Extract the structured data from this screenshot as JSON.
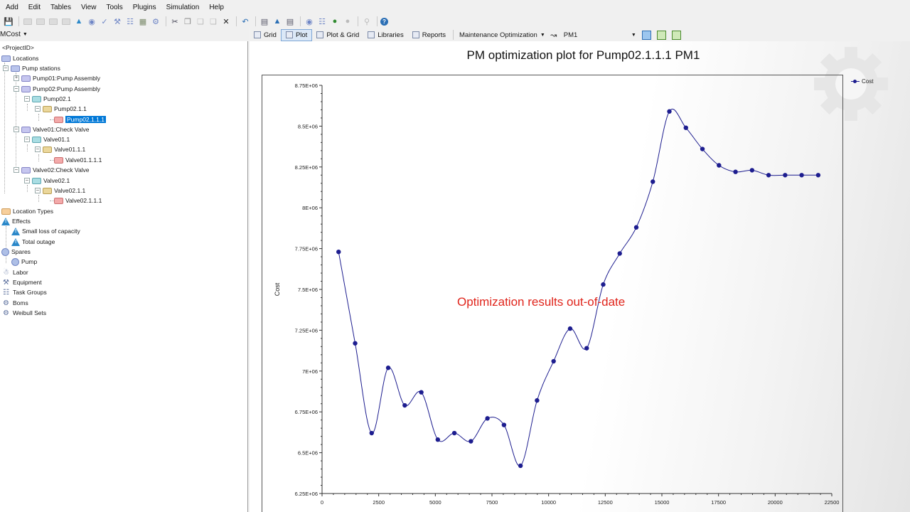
{
  "menu": [
    "Add",
    "Edit",
    "Tables",
    "View",
    "Tools",
    "Plugins",
    "Simulation",
    "Help"
  ],
  "left_header": {
    "label": "MCost"
  },
  "tree": {
    "project_label": "<ProjectID>",
    "locations": "Locations",
    "pump_stations": "Pump stations",
    "pump01": "Pump01:Pump Assembly",
    "pump02": "Pump02:Pump Assembly",
    "pump02_1": "Pump02.1",
    "pump02_1_1": "Pump02.1.1",
    "pump02_1_1_1": "Pump02.1.1.1",
    "valve01": "Valve01:Check Valve",
    "valve01_1": "Valve01.1",
    "valve01_1_1": "Valve01.1.1",
    "valve01_1_1_1": "Valve01.1.1.1",
    "valve02": "Valve02:Check Valve",
    "valve02_1": "Valve02.1",
    "valve02_1_1": "Valve02.1.1",
    "valve02_1_1_1": "Valve02.1.1.1",
    "location_types": "Location Types",
    "effects": "Effects",
    "small_loss": "Small loss of capacity",
    "total_outage": "Total outage",
    "spares": "Spares",
    "pump": "Pump",
    "labor": "Labor",
    "equipment": "Equipment",
    "task_groups": "Task Groups",
    "boms": "Boms",
    "weibull_sets": "Weibull Sets"
  },
  "tabs": {
    "grid": "Grid",
    "plot": "Plot",
    "plot_grid": "Plot & Grid",
    "libraries": "Libraries",
    "reports": "Reports",
    "maintenance": "Maintenance Optimization",
    "pm_select": "PM1"
  },
  "plot": {
    "title": "PM optimization plot for Pump02.1.1.1 PM1",
    "warning": "Optimization results out-of-date",
    "legend": "Cost"
  },
  "colors": {
    "series": "#1d1d8f",
    "warning": "#e0241b",
    "selection": "#0078d7"
  },
  "chart_data": {
    "type": "line",
    "title": "PM optimization plot for Pump02.1.1.1 PM1",
    "xlabel": "",
    "ylabel": "Cost",
    "xlim": [
      0,
      22500
    ],
    "ylim": [
      6250000,
      8750000
    ],
    "x_ticks": [
      "0",
      "2500",
      "5000",
      "7500",
      "10000",
      "12500",
      "15000",
      "17500",
      "20000",
      "22500"
    ],
    "y_ticks": [
      "6.25E+06",
      "6.5E+06",
      "6.75E+06",
      "7E+06",
      "7.25E+06",
      "7.5E+06",
      "7.75E+06",
      "8E+06",
      "8.25E+06",
      "8.5E+06",
      "8.75E+06"
    ],
    "legend_position": "top-right",
    "series": [
      {
        "name": "Cost",
        "x": [
          730,
          1460,
          2190,
          2920,
          3650,
          4380,
          5110,
          5840,
          6570,
          7300,
          8030,
          8760,
          9490,
          10220,
          10950,
          11680,
          12410,
          13140,
          13870,
          14600,
          15330,
          16060,
          16790,
          17520,
          18250,
          18980,
          19710,
          20440,
          21170,
          21900
        ],
        "y": [
          7730000,
          7170000,
          6620000,
          7020000,
          6790000,
          6870000,
          6580000,
          6620000,
          6570000,
          6710000,
          6670000,
          6420000,
          6820000,
          7060000,
          7260000,
          7140000,
          7530000,
          7720000,
          7880000,
          8160000,
          8590000,
          8490000,
          8360000,
          8260000,
          8220000,
          8230000,
          8200000,
          8200000,
          8200000,
          8200000
        ]
      }
    ]
  }
}
